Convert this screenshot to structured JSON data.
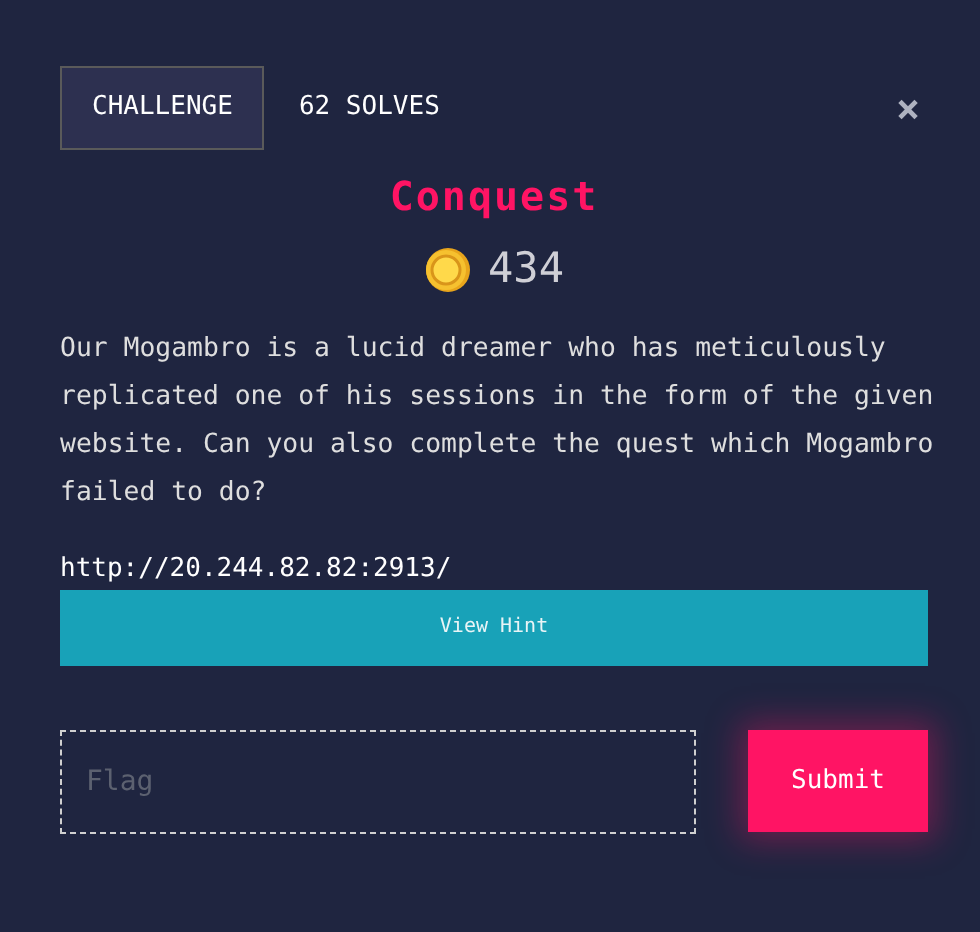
{
  "tabs": [
    {
      "label": "CHALLENGE",
      "selected": true
    }
  ],
  "solves": "62 SOLVES",
  "close": "×",
  "challenge": {
    "title": "Conquest",
    "points": "434",
    "description": "Our Mogambro is a lucid dreamer who has meticulously replicated one of his sessions in the form of the given website. Can you also complete the quest which Mogambro failed to do?",
    "url": "http://20.244.82.82:2913/"
  },
  "hint_button": "View Hint",
  "flag": {
    "placeholder": "Flag"
  },
  "submit_button": "Submit"
}
